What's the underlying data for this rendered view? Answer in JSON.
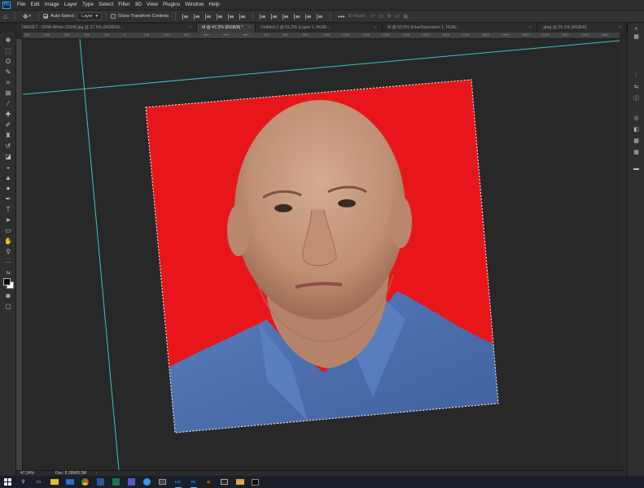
{
  "app": {
    "logo": "Ps"
  },
  "menubar": {
    "items": [
      "File",
      "Edit",
      "Image",
      "Layer",
      "Type",
      "Select",
      "Filter",
      "3D",
      "View",
      "Plugins",
      "Window",
      "Help"
    ]
  },
  "options": {
    "auto_select_label": "Auto-Select:",
    "auto_select_checked": true,
    "layer_select_value": "Layer",
    "show_transform_label": "Show Transform Controls",
    "show_transform_checked": false,
    "mode_3d_label": "3D Mode:"
  },
  "tabs": [
    {
      "label": "TARGET - IDPA-White-22940.jpg @ 27.5% (RGB/16...",
      "active": false
    },
    {
      "label": "tif @ 47.2% (RGB/8) *",
      "active": true
    },
    {
      "label": "Untitled-2 @ 51.2% (Layer 1, RGB/...",
      "active": false
    },
    {
      "label": "tif @ 53.5% (Hue/Saturation 1, RGB/...",
      "active": false
    },
    {
      "label": ".jpeg @ 25.1% (RGB/8)",
      "active": false
    }
  ],
  "ruler_top_ticks": [
    "500",
    "400",
    "300",
    "200",
    "100",
    "0",
    "100",
    "200",
    "300",
    "400",
    "500",
    "600",
    "700",
    "800",
    "900",
    "1000",
    "1100",
    "1200",
    "1300",
    "1400",
    "1500",
    "1600",
    "1700",
    "1800",
    "1900",
    "2000",
    "2100",
    "2200",
    "2300",
    "2400"
  ],
  "status": {
    "zoom": "47.24%",
    "doc": "Doc: 8.28M/8.3M"
  },
  "colors": {
    "canvas_background": "#282828",
    "photo_background": "#e8161a",
    "guide": "#3fc3c8",
    "shirt": "#4f73b0",
    "skin": "#c89a7e"
  },
  "icons": {
    "toolbar": [
      "move-icon",
      "marquee-icon",
      "lasso-icon",
      "quick-select-icon",
      "crop-icon",
      "frame-icon",
      "eyedropper-icon",
      "healing-brush-icon",
      "brush-icon",
      "clone-stamp-icon",
      "history-brush-icon",
      "eraser-icon",
      "paint-bucket-icon",
      "blur-icon",
      "dodge-icon",
      "pen-icon",
      "type-icon",
      "path-select-icon",
      "shape-icon",
      "hand-icon",
      "zoom-icon",
      "more-tools-icon",
      "swap-colors-icon",
      "foreground-color-icon",
      "quick-mask-icon",
      "screen-mode-icon"
    ],
    "right_panel": [
      "collapse-panels-icon",
      "adjustments-icon",
      "properties-icon",
      "info-icon",
      "layers-icon",
      "channels-icon",
      "paths-icon",
      "swatches-icon",
      "libraries-icon"
    ],
    "taskbar": [
      "windows-start-icon",
      "search-icon",
      "task-view-icon",
      "file-explorer-icon",
      "mail-icon",
      "chrome-icon",
      "word-icon",
      "excel-icon",
      "teams-icon",
      "edge-icon",
      "camera-icon",
      "lightroom-classic-icon",
      "photoshop-icon",
      "bridge-icon",
      "media-icon",
      "folder-icon",
      "terminal-icon"
    ]
  },
  "taskbar_labels": {
    "lightroom": "LrC",
    "photoshop": "Ps",
    "bridge": "Br"
  }
}
